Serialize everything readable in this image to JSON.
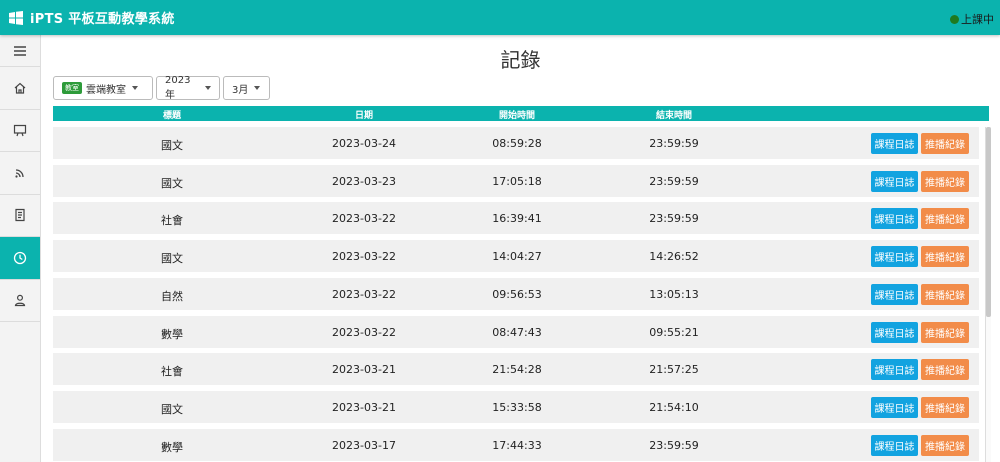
{
  "app": {
    "title": "iPTS 平板互動教學系統",
    "status": "上課中"
  },
  "sidebar": {
    "items": [
      {
        "icon": "menu-icon",
        "active": false
      },
      {
        "icon": "home-icon",
        "active": false
      },
      {
        "icon": "board-icon",
        "active": false
      },
      {
        "icon": "broadcast-icon",
        "active": false
      },
      {
        "icon": "document-icon",
        "active": false
      },
      {
        "icon": "clock-icon",
        "active": true
      },
      {
        "icon": "user-icon",
        "active": false
      }
    ]
  },
  "page": {
    "title": "記錄"
  },
  "filters": {
    "classroom_badge": "教室",
    "classroom": "雲端教室",
    "year": "2023年",
    "month": "3月"
  },
  "table": {
    "headers": {
      "subject": "標題",
      "date": "日期",
      "start": "開始時間",
      "end": "結束時間"
    },
    "rows": [
      {
        "subject": "國文",
        "date": "2023-03-24",
        "start": "08:59:28",
        "end": "23:59:59",
        "log": "課程日誌",
        "cast": "推播紀錄"
      },
      {
        "subject": "國文",
        "date": "2023-03-23",
        "start": "17:05:18",
        "end": "23:59:59",
        "log": "課程日誌",
        "cast": "推播紀錄"
      },
      {
        "subject": "社會",
        "date": "2023-03-22",
        "start": "16:39:41",
        "end": "23:59:59",
        "log": "課程日誌",
        "cast": "推播紀錄"
      },
      {
        "subject": "國文",
        "date": "2023-03-22",
        "start": "14:04:27",
        "end": "14:26:52",
        "log": "課程日誌",
        "cast": "推播紀錄"
      },
      {
        "subject": "自然",
        "date": "2023-03-22",
        "start": "09:56:53",
        "end": "13:05:13",
        "log": "課程日誌",
        "cast": "推播紀錄"
      },
      {
        "subject": "數學",
        "date": "2023-03-22",
        "start": "08:47:43",
        "end": "09:55:21",
        "log": "課程日誌",
        "cast": "推播紀錄"
      },
      {
        "subject": "社會",
        "date": "2023-03-21",
        "start": "21:54:28",
        "end": "21:57:25",
        "log": "課程日誌",
        "cast": "推播紀錄"
      },
      {
        "subject": "國文",
        "date": "2023-03-21",
        "start": "15:33:58",
        "end": "21:54:10",
        "log": "課程日誌",
        "cast": "推播紀錄"
      },
      {
        "subject": "數學",
        "date": "2023-03-17",
        "start": "17:44:33",
        "end": "23:59:59",
        "log": "課程日誌",
        "cast": "推播紀錄"
      }
    ]
  },
  "colors": {
    "accent": "#0bb3ae",
    "log_button": "#12a3e0",
    "cast_button": "#f28c49",
    "status_dot": "#1f7a1f"
  }
}
